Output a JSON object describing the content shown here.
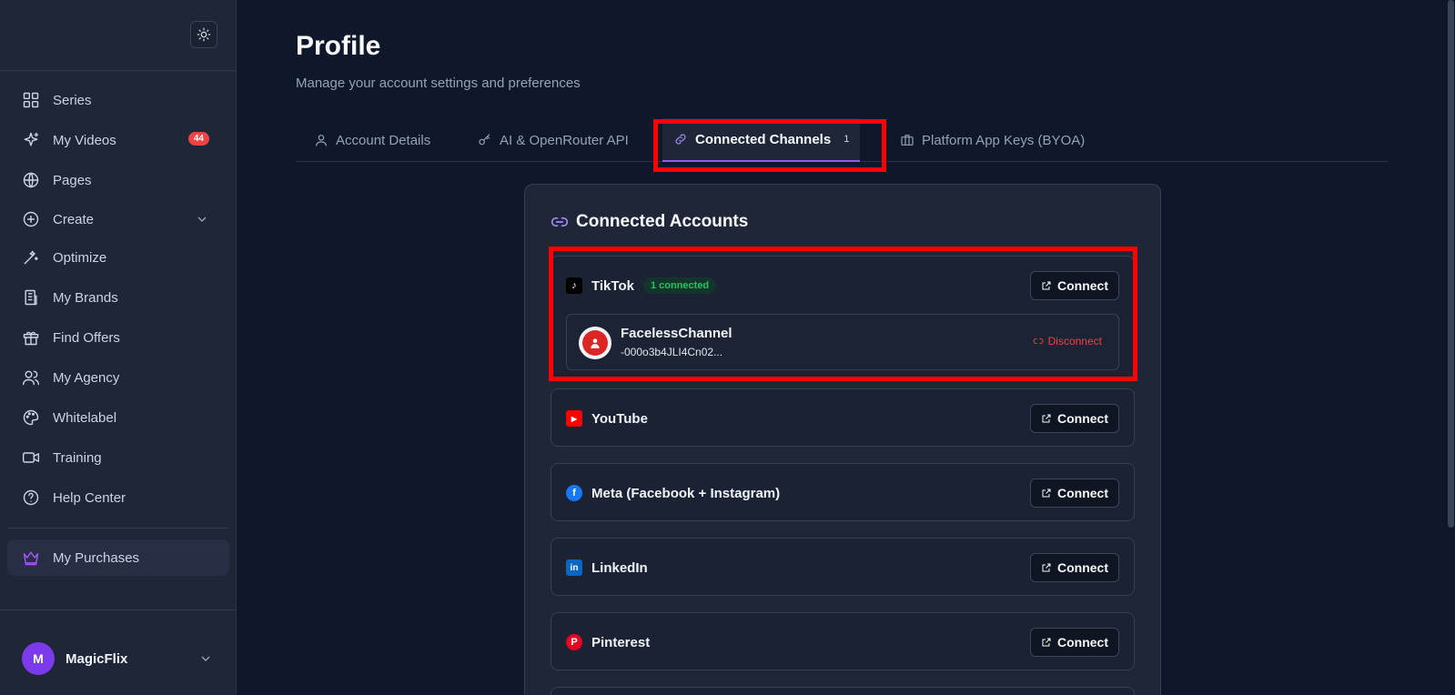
{
  "sidebar": {
    "items": [
      {
        "label": "Series",
        "icon": "grid-icon"
      },
      {
        "label": "My Videos",
        "icon": "sparkles-icon",
        "badge": "44"
      },
      {
        "label": "Pages",
        "icon": "globe-icon"
      },
      {
        "label": "Create",
        "icon": "plus-circle-icon"
      },
      {
        "label": "Optimize",
        "icon": "magic-wand-icon"
      },
      {
        "label": "My Brands",
        "icon": "building-icon"
      },
      {
        "label": "Find Offers",
        "icon": "gift-icon"
      },
      {
        "label": "My Agency",
        "icon": "users-icon"
      },
      {
        "label": "Whitelabel",
        "icon": "palette-icon"
      },
      {
        "label": "Training",
        "icon": "video-icon"
      },
      {
        "label": "Help Center",
        "icon": "help-circle-icon"
      },
      {
        "label": "My Purchases",
        "icon": "crown-icon"
      }
    ],
    "user": {
      "initial": "M",
      "name": "MagicFlix"
    }
  },
  "header": {
    "title": "Profile",
    "subtitle": "Manage your account settings and preferences"
  },
  "tabs": [
    {
      "label": "Account Details",
      "icon": "user-icon"
    },
    {
      "label": "AI & OpenRouter API",
      "icon": "key-icon"
    },
    {
      "label": "Connected Channels",
      "icon": "link-icon",
      "count": "1",
      "active": true
    },
    {
      "label": "Platform App Keys (BYOA)",
      "icon": "briefcase-icon"
    }
  ],
  "panel": {
    "title": "Connected Accounts",
    "connect_label": "Connect",
    "disconnect_label": "Disconnect",
    "channels": [
      {
        "name": "TikTok",
        "badge": "1 connected",
        "account": {
          "name": "FacelessChannel",
          "id": "-000o3b4JLI4Cn02..."
        }
      },
      {
        "name": "YouTube"
      },
      {
        "name": "Meta (Facebook + Instagram)"
      },
      {
        "name": "LinkedIn"
      },
      {
        "name": "Pinterest"
      }
    ]
  },
  "colors": {
    "background": "#0f172a",
    "sidebar": "#1e2637",
    "accent": "#8b5cf6",
    "highlight": "#ff0000",
    "success": "#22c55e",
    "danger": "#ef4444"
  }
}
